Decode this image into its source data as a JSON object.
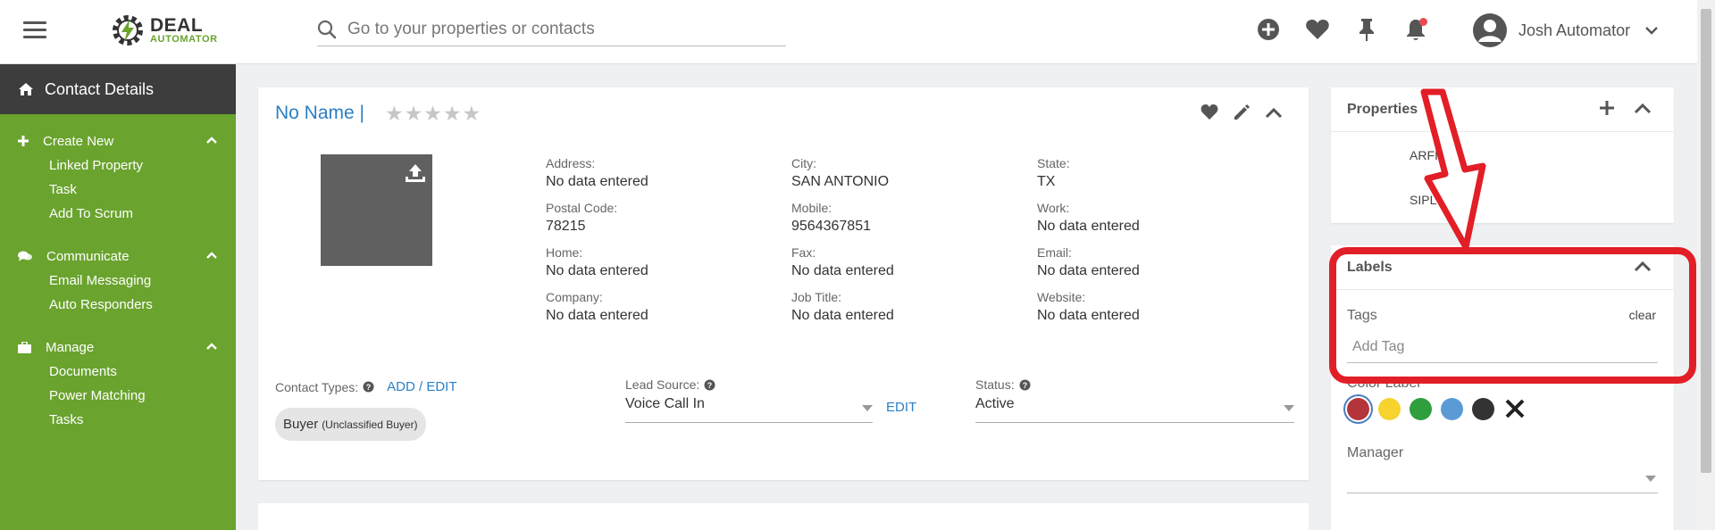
{
  "header": {
    "logo_deal": "DEAL",
    "logo_automator": "AUTOMATOR",
    "search_placeholder": "Go to your properties or contacts",
    "user_name": "Josh Automator"
  },
  "sidebar": {
    "title": "Contact Details",
    "sections": [
      {
        "title": "Create New",
        "items": [
          "Linked Property",
          "Task",
          "Add To Scrum"
        ]
      },
      {
        "title": "Communicate",
        "items": [
          "Email Messaging",
          "Auto Responders"
        ]
      },
      {
        "title": "Manage",
        "items": [
          "Documents",
          "Power Matching",
          "Tasks"
        ]
      }
    ]
  },
  "contact": {
    "name": "No Name |",
    "rating": 0,
    "fields": [
      {
        "label": "Address:",
        "value": "No data entered"
      },
      {
        "label": "City:",
        "value": "SAN ANTONIO"
      },
      {
        "label": "State:",
        "value": "TX"
      },
      {
        "label": "Postal Code:",
        "value": "78215"
      },
      {
        "label": "Mobile:",
        "value": "9564367851"
      },
      {
        "label": "Work:",
        "value": "No data entered"
      },
      {
        "label": "Home:",
        "value": "No data entered"
      },
      {
        "label": "Fax:",
        "value": "No data entered"
      },
      {
        "label": "Email:",
        "value": "No data entered"
      },
      {
        "label": "Company:",
        "value": "No data entered"
      },
      {
        "label": "Job Title:",
        "value": "No data entered"
      },
      {
        "label": "Website:",
        "value": "No data entered"
      }
    ],
    "contact_types_label": "Contact Types:",
    "add_edit_label": "ADD / EDIT",
    "contact_type_chip": "Buyer",
    "contact_type_sub": "(Unclassified Buyer)",
    "lead_source_label": "Lead Source:",
    "lead_source_value": "Voice Call In",
    "lead_source_edit": "EDIT",
    "status_label": "Status:",
    "status_value": "Active"
  },
  "properties_panel": {
    "title": "Properties",
    "line1": "ARFIE",
    "line2": "SIPL"
  },
  "labels_panel": {
    "title": "Labels",
    "tags_label": "Tags",
    "clear_label": "clear",
    "tag_placeholder": "Add Tag",
    "color_label": "Color Label",
    "colors": [
      "#b3343a",
      "#f6d32d",
      "#2f9e3c",
      "#5a9bd6",
      "#333333"
    ],
    "manager_label": "Manager"
  },
  "colors": {
    "brand_green": "#6aa32e",
    "sidebar_header": "#3d3d3d",
    "link_blue": "#2a7fc5",
    "annotation_red": "#e21e26"
  }
}
